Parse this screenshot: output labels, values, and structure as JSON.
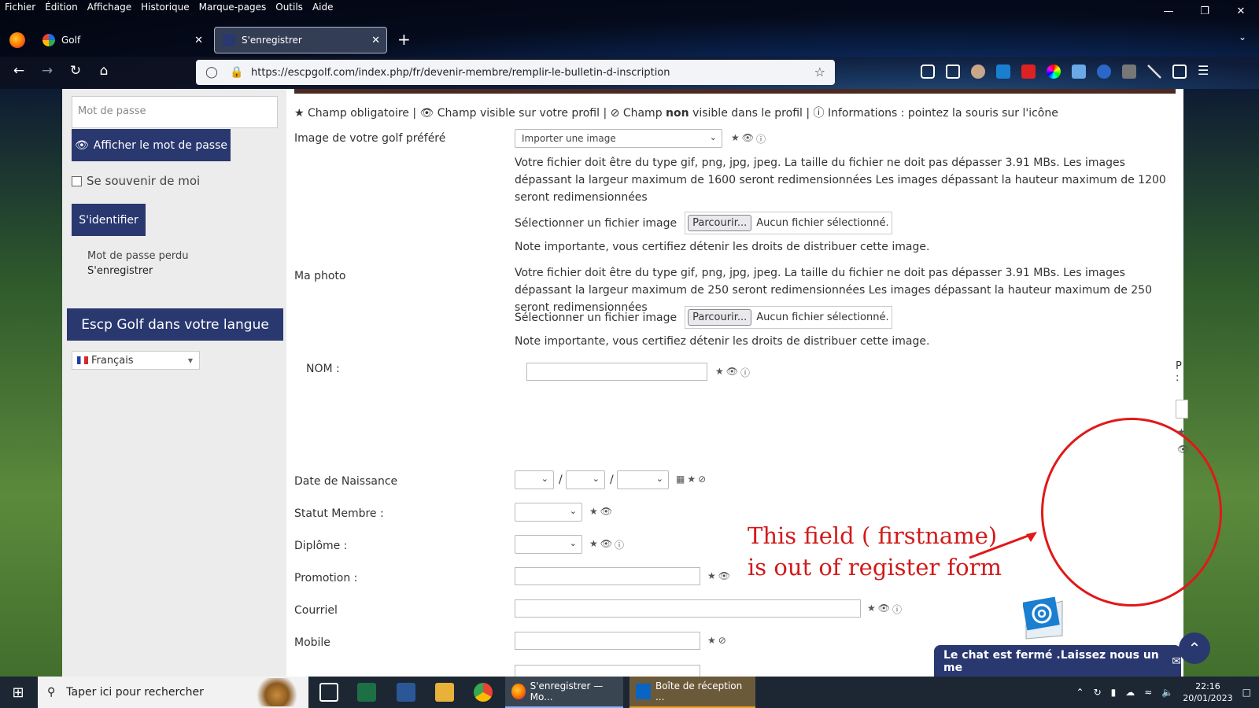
{
  "menubar": [
    "Fichier",
    "Édition",
    "Affichage",
    "Historique",
    "Marque-pages",
    "Outils",
    "Aide"
  ],
  "tabs": [
    {
      "label": "Golf"
    },
    {
      "label": "S'enregistrer"
    }
  ],
  "url": "https://escpgolf.com/index.php/fr/devenir-membre/remplir-le-bulletin-d-inscription",
  "sidebar": {
    "password_placeholder": "Mot de passe",
    "show_password": "Afficher le mot de passe",
    "remember_me": "Se souvenir de moi",
    "login": "S'identifier",
    "lost_password": "Mot de passe perdu",
    "register": "S'enregistrer",
    "language_header": "Escp Golf dans votre langue",
    "language_selected": "Français"
  },
  "form": {
    "legend": {
      "required": "Champ obligatoire |",
      "visible": "Champ visible sur votre profil |",
      "not_visible_prefix": "Champ",
      "not_visible_bold": "non",
      "not_visible_suffix": "visible dans le profil |",
      "info": "Informations : pointez la souris sur l'icône"
    },
    "golf_image_label": "Image de votre golf préféré",
    "golf_image_select": "Importer une image",
    "golf_image_help": "Votre fichier doit être du type gif, png, jpg, jpeg. La taille du fichier ne doit pas dépasser 3.91 MBs. Les images dépassant la largeur maximum de 1600 seront redimensionnées Les images dépassant la hauteur maximum de 1200 seront redimensionnées",
    "select_file_label": "Sélectionner un fichier image",
    "browse_button": "Parcourir...",
    "no_file": "Aucun fichier sélectionné.",
    "rights_note": "Note importante, vous certifiez détenir les droits de distribuer cette image.",
    "photo_label": "Ma photo",
    "photo_help": "Votre fichier doit être du type gif, png, jpg, jpeg. La taille du fichier ne doit pas dépasser 3.91 MBs. Les images dépassant la largeur maximum de 250 seront redimensionnées Les images dépassant la hauteur maximum de 250 seront redimensionnées",
    "nom_label": "NOM :",
    "birth_label": "Date de Naissance",
    "status_label": "Statut Membre :",
    "diploma_label": "Diplôme :",
    "promotion_label": "Promotion :",
    "email_label": "Courriel",
    "mobile_label": "Mobile",
    "overflow_fragment_text": "P\n:"
  },
  "annotation": {
    "line1": "This field ( firstname)",
    "line2": "is out of register form"
  },
  "chat": "Le chat est fermé .Laissez nous un me",
  "taskbar": {
    "search": "Taper ici pour rechercher",
    "firefox_app": "S'enregistrer — Mo...",
    "outlook_app": "Boîte de réception ...",
    "time": "22:16",
    "date": "20/01/2023"
  },
  "colors": {
    "primary": "#2a3870",
    "annotation": "#d21a1a"
  }
}
